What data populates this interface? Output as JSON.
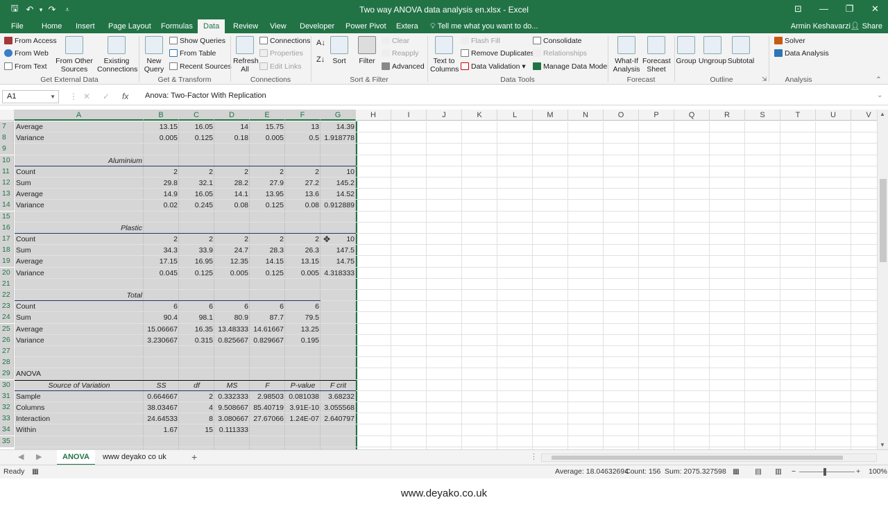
{
  "window": {
    "title": "Two way ANOVA data analysis en.xlsx - Excel",
    "minimize": "—",
    "restore": "❐",
    "close": "✕",
    "ribbon_display": "⊡"
  },
  "quick_access": {
    "save": "🖫",
    "undo": "↶",
    "undo_dd": "▾",
    "redo": "↷",
    "customize": "⩡"
  },
  "tabs": [
    "File",
    "Home",
    "Insert",
    "Page Layout",
    "Formulas",
    "Data",
    "Review",
    "View",
    "Developer",
    "Power Pivot",
    "Extera"
  ],
  "active_tab": "Data",
  "tell_me": "Tell me what you want to do...",
  "user": "Armin Keshavarzi",
  "share": "Share",
  "ribbon": {
    "get_external": {
      "label": "Get External Data",
      "from_access": "From Access",
      "from_web": "From Web",
      "from_text": "From Text",
      "from_other": "From Other Sources",
      "existing": "Existing Connections"
    },
    "get_transform": {
      "label": "Get & Transform",
      "new_query": "New Query",
      "show_queries": "Show Queries",
      "from_table": "From Table",
      "recent_sources": "Recent Sources"
    },
    "connections": {
      "label": "Connections",
      "refresh_all": "Refresh All",
      "connections": "Connections",
      "properties": "Properties",
      "edit_links": "Edit Links"
    },
    "sort_filter": {
      "label": "Sort & Filter",
      "sort": "Sort",
      "filter": "Filter",
      "clear": "Clear",
      "reapply": "Reapply",
      "advanced": "Advanced"
    },
    "data_tools": {
      "label": "Data Tools",
      "text_to_columns": "Text to Columns",
      "flash_fill": "Flash Fill",
      "remove_duplicates": "Remove Duplicates",
      "data_validation": "Data Validation",
      "consolidate": "Consolidate",
      "relationships": "Relationships",
      "manage_data_model": "Manage Data Model"
    },
    "forecast": {
      "label": "Forecast",
      "what_if": "What-If Analysis",
      "forecast_sheet": "Forecast Sheet"
    },
    "outline": {
      "label": "Outline",
      "group": "Group",
      "ungroup": "Ungroup",
      "subtotal": "Subtotal"
    },
    "analysis": {
      "label": "Analysis",
      "solver": "Solver",
      "data_analysis": "Data Analysis"
    }
  },
  "formula_bar": {
    "name_box": "A1",
    "cancel": "✕",
    "enter": "✓",
    "fx": "fx",
    "formula": "Anova: Two-Factor With Replication"
  },
  "columns": [
    "A",
    "B",
    "C",
    "D",
    "E",
    "F",
    "G",
    "H",
    "I",
    "J",
    "K",
    "L",
    "M",
    "N",
    "O",
    "P",
    "Q",
    "R",
    "S",
    "T",
    "U",
    "V"
  ],
  "rows": [
    {
      "n": "7",
      "a": "Average",
      "v": [
        "13.15",
        "16.05",
        "14",
        "15.75",
        "13",
        "14.39"
      ]
    },
    {
      "n": "8",
      "a": "Variance",
      "v": [
        "0.005",
        "0.125",
        "0.18",
        "0.005",
        "0.5",
        "1.918778"
      ]
    },
    {
      "n": "9",
      "a": "",
      "v": []
    },
    {
      "n": "10",
      "a": "Aluminium",
      "center": true,
      "v": []
    },
    {
      "n": "11",
      "a": "Count",
      "v": [
        "2",
        "2",
        "2",
        "2",
        "2",
        "10"
      ]
    },
    {
      "n": "12",
      "a": "Sum",
      "v": [
        "29.8",
        "32.1",
        "28.2",
        "27.9",
        "27.2",
        "145.2"
      ]
    },
    {
      "n": "13",
      "a": "Average",
      "v": [
        "14.9",
        "16.05",
        "14.1",
        "13.95",
        "13.6",
        "14.52"
      ]
    },
    {
      "n": "14",
      "a": "Variance",
      "v": [
        "0.02",
        "0.245",
        "0.08",
        "0.125",
        "0.08",
        "0.912889"
      ]
    },
    {
      "n": "15",
      "a": "",
      "v": []
    },
    {
      "n": "16",
      "a": "Plastic",
      "center": true,
      "v": []
    },
    {
      "n": "17",
      "a": "Count",
      "v": [
        "2",
        "2",
        "2",
        "2",
        "2",
        "10"
      ]
    },
    {
      "n": "18",
      "a": "Sum",
      "v": [
        "34.3",
        "33.9",
        "24.7",
        "28.3",
        "26.3",
        "147.5"
      ]
    },
    {
      "n": "19",
      "a": "Average",
      "v": [
        "17.15",
        "16.95",
        "12.35",
        "14.15",
        "13.15",
        "14.75"
      ]
    },
    {
      "n": "20",
      "a": "Variance",
      "v": [
        "0.045",
        "0.125",
        "0.005",
        "0.125",
        "0.005",
        "4.318333"
      ]
    },
    {
      "n": "21",
      "a": "",
      "v": []
    },
    {
      "n": "22",
      "a": "Total",
      "center": true,
      "v": []
    },
    {
      "n": "23",
      "a": "Count",
      "v": [
        "6",
        "6",
        "6",
        "6",
        "6"
      ]
    },
    {
      "n": "24",
      "a": "Sum",
      "v": [
        "90.4",
        "98.1",
        "80.9",
        "87.7",
        "79.5"
      ]
    },
    {
      "n": "25",
      "a": "Average",
      "v": [
        "15.06667",
        "16.35",
        "13.48333",
        "14.61667",
        "13.25"
      ]
    },
    {
      "n": "26",
      "a": "Variance",
      "v": [
        "3.230667",
        "0.315",
        "0.825667",
        "0.829667",
        "0.195"
      ]
    },
    {
      "n": "27",
      "a": "",
      "v": []
    },
    {
      "n": "28",
      "a": "",
      "v": []
    },
    {
      "n": "29",
      "a": "ANOVA",
      "v": []
    },
    {
      "n": "30",
      "a": "Source of Variation",
      "center": true,
      "hdr": true,
      "v": [
        "SS",
        "df",
        "MS",
        "F",
        "P-value",
        "F crit"
      ]
    },
    {
      "n": "31",
      "a": "Sample",
      "v": [
        "0.664667",
        "2",
        "0.332333",
        "2.98503",
        "0.081038",
        "3.68232"
      ]
    },
    {
      "n": "32",
      "a": "Columns",
      "v": [
        "38.03467",
        "4",
        "9.508667",
        "85.40719",
        "3.91E-10",
        "3.055568"
      ]
    },
    {
      "n": "33",
      "a": "Interaction",
      "v": [
        "24.64533",
        "8",
        "3.080667",
        "27.67066",
        "1.24E-07",
        "2.640797"
      ]
    },
    {
      "n": "34",
      "a": "Within",
      "v": [
        "1.67",
        "15",
        "0.111333"
      ]
    },
    {
      "n": "35",
      "a": "",
      "v": []
    }
  ],
  "sheets": [
    "ANOVA",
    "www deyako co uk"
  ],
  "active_sheet": "ANOVA",
  "add_sheet": "+",
  "status": {
    "ready": "Ready",
    "average": "Average: 18.04632694",
    "count": "Count: 156",
    "sum": "Sum: 2075.327598",
    "zoom": "100%",
    "zoom_minus": "−",
    "zoom_plus": "+"
  },
  "footer": "www.deyako.co.uk"
}
